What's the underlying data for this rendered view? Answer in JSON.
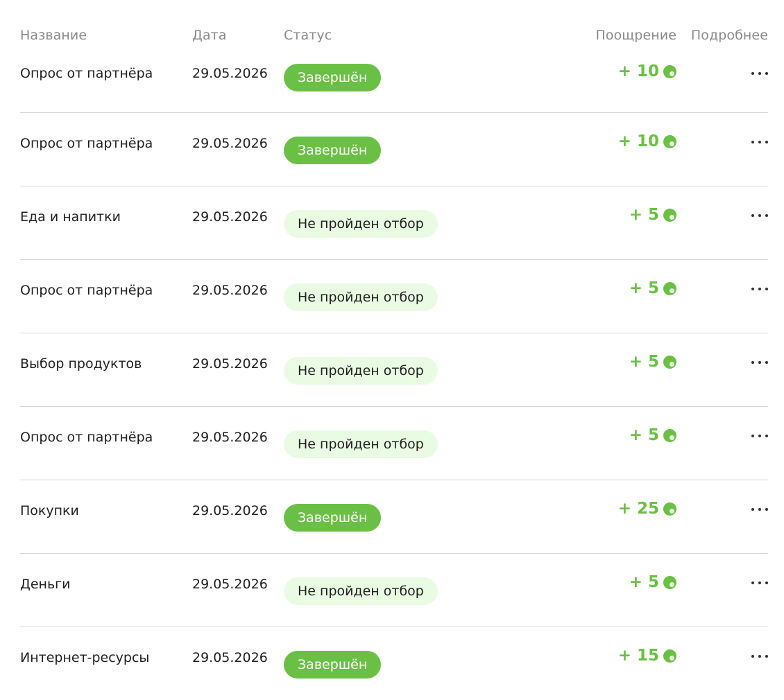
{
  "header": {
    "name": "Название",
    "date": "Дата",
    "status": "Статус",
    "reward": "Поощрение",
    "details": "Подробнее"
  },
  "colors": {
    "accent": "#6ac044",
    "badge_done_bg": "#6ac044",
    "badge_fail_bg": "#eafbe3"
  },
  "rows": [
    {
      "name": "Опрос от партнёра",
      "date": "29.05.2026",
      "status": "Завершён",
      "status_type": "done",
      "reward": "+ 10",
      "icon": "coin-icon"
    },
    {
      "name": "Опрос от партнёра",
      "date": "29.05.2026",
      "status": "Завершён",
      "status_type": "done",
      "reward": "+ 10",
      "icon": "coin-icon"
    },
    {
      "name": "Еда и напитки",
      "date": "29.05.2026",
      "status": "Не пройден отбор",
      "status_type": "fail",
      "reward": "+ 5",
      "icon": "coin-icon"
    },
    {
      "name": "Опрос от партнёра",
      "date": "29.05.2026",
      "status": "Не пройден отбор",
      "status_type": "fail",
      "reward": "+ 5",
      "icon": "coin-icon"
    },
    {
      "name": "Выбор продуктов",
      "date": "29.05.2026",
      "status": "Не пройден отбор",
      "status_type": "fail",
      "reward": "+ 5",
      "icon": "coin-icon"
    },
    {
      "name": "Опрос от партнёра",
      "date": "29.05.2026",
      "status": "Не пройден отбор",
      "status_type": "fail",
      "reward": "+ 5",
      "icon": "coin-icon"
    },
    {
      "name": "Покупки",
      "date": "29.05.2026",
      "status": "Завершён",
      "status_type": "done",
      "reward": "+ 25",
      "icon": "coin-icon"
    },
    {
      "name": "Деньги",
      "date": "29.05.2026",
      "status": "Не пройден отбор",
      "status_type": "fail",
      "reward": "+ 5",
      "icon": "coin-icon"
    },
    {
      "name": "Интернет-ресурсы",
      "date": "29.05.2026",
      "status": "Завершён",
      "status_type": "done",
      "reward": "+ 15",
      "icon": "coin-icon"
    }
  ]
}
